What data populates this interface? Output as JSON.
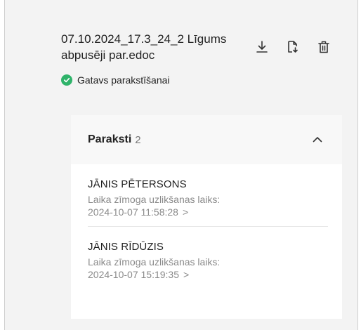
{
  "document": {
    "filename": "07.10.2024_17.3_24_2 Līgums abpusēji par.edoc",
    "status": "Gatavs parakstīšanai",
    "status_color": "#2fb36a"
  },
  "actions": {
    "download_icon": "download-icon",
    "copy_icon": "file-copy-icon",
    "delete_icon": "trash-icon"
  },
  "signatures": {
    "title": "Paraksti",
    "count": "2",
    "items": [
      {
        "name": "JĀNIS PĒTERSONS",
        "label": "Laika zīmoga uzlikšanas laiks:",
        "time": "2024-10-07 11:58:28",
        "arrow": ">"
      },
      {
        "name": "JĀNIS RĪDŪZIS",
        "label": "Laika zīmoga uzlikšanas laiks:",
        "time": "2024-10-07 15:19:35",
        "arrow": ">"
      }
    ]
  }
}
